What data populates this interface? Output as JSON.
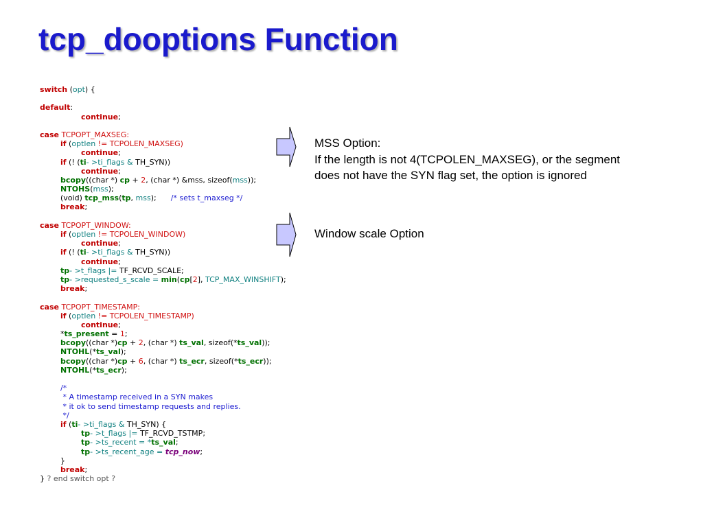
{
  "title": "tcp_dooptions Function",
  "notes": {
    "mss": [
      "MSS Option:",
      "If the length is not 4(TCPOLEN_MAXSEG), or the segment",
      "does not have the SYN flag set, the option is ignored"
    ],
    "window": [
      "Window scale Option"
    ]
  },
  "colors": {
    "title": "#1a1acc",
    "arrow_fill": "#c8c8ff",
    "keyword": "#c00000",
    "identifier": "#108080",
    "function": "#007000",
    "comment": "#1a1ad0"
  },
  "icons": [
    "right-arrow-icon"
  ],
  "code_lines": [
    {
      "indent": 0,
      "tokens": [
        [
          "switch",
          "kw"
        ],
        [
          " (",
          "black"
        ],
        [
          "opt",
          "teal"
        ],
        [
          ") {",
          "black"
        ]
      ]
    },
    {
      "indent": 0,
      "tokens": []
    },
    {
      "indent": 0,
      "tokens": [
        [
          "default",
          "kw"
        ],
        [
          ":",
          "black"
        ]
      ]
    },
    {
      "indent": 2,
      "tokens": [
        [
          "continue",
          "kw"
        ],
        [
          ";",
          "black"
        ]
      ]
    },
    {
      "indent": 0,
      "tokens": []
    },
    {
      "indent": 0,
      "tokens": [
        [
          "case",
          "kw"
        ],
        [
          " TCPOPT_MAXSEG:",
          "red"
        ]
      ]
    },
    {
      "indent": 1,
      "tokens": [
        [
          "if",
          "kw"
        ],
        [
          " (",
          "black"
        ],
        [
          "optlen",
          "teal"
        ],
        [
          " != TCPOLEN_MAXSEG)",
          "red"
        ]
      ]
    },
    {
      "indent": 2,
      "tokens": [
        [
          "continue",
          "kw"
        ],
        [
          ";",
          "black"
        ]
      ]
    },
    {
      "indent": 1,
      "tokens": [
        [
          "if",
          "kw"
        ],
        [
          " (! (",
          "black"
        ],
        [
          "ti",
          "green"
        ],
        [
          "- >ti_flags & ",
          "teal"
        ],
        [
          "TH_SYN",
          "black"
        ],
        [
          "))",
          "black"
        ]
      ]
    },
    {
      "indent": 2,
      "tokens": [
        [
          "continue",
          "kw"
        ],
        [
          ";",
          "black"
        ]
      ]
    },
    {
      "indent": 1,
      "tokens": [
        [
          "bcopy",
          "green"
        ],
        [
          "((char *) ",
          "black"
        ],
        [
          "cp",
          "green"
        ],
        [
          " + ",
          "black"
        ],
        [
          "2",
          "num"
        ],
        [
          ", (char *) &mss, sizeof(",
          "black"
        ],
        [
          "mss",
          "teal"
        ],
        [
          "));",
          "black"
        ]
      ]
    },
    {
      "indent": 1,
      "tokens": [
        [
          "NTOHS",
          "green"
        ],
        [
          "(",
          "black"
        ],
        [
          "mss",
          "teal"
        ],
        [
          ");",
          "black"
        ]
      ]
    },
    {
      "indent": 1,
      "tokens": [
        [
          "(void) ",
          "black"
        ],
        [
          "tcp_mss",
          "green"
        ],
        [
          "(",
          "black"
        ],
        [
          "tp",
          "green"
        ],
        [
          ", ",
          "black"
        ],
        [
          "mss",
          "teal"
        ],
        [
          ");      ",
          "black"
        ],
        [
          "/* sets t_maxseg */",
          "comment"
        ]
      ]
    },
    {
      "indent": 1,
      "tokens": [
        [
          "break",
          "kw"
        ],
        [
          ";",
          "black"
        ]
      ]
    },
    {
      "indent": 0,
      "tokens": []
    },
    {
      "indent": 0,
      "tokens": [
        [
          "case",
          "kw"
        ],
        [
          " TCPOPT_WINDOW:",
          "red"
        ]
      ]
    },
    {
      "indent": 1,
      "tokens": [
        [
          "if",
          "kw"
        ],
        [
          " (",
          "black"
        ],
        [
          "optlen",
          "teal"
        ],
        [
          " != TCPOLEN_WINDOW)",
          "red"
        ]
      ]
    },
    {
      "indent": 2,
      "tokens": [
        [
          "continue",
          "kw"
        ],
        [
          ";",
          "black"
        ]
      ]
    },
    {
      "indent": 1,
      "tokens": [
        [
          "if",
          "kw"
        ],
        [
          " (! (",
          "black"
        ],
        [
          "ti",
          "green"
        ],
        [
          "- >ti_flags & ",
          "teal"
        ],
        [
          "TH_SYN",
          "black"
        ],
        [
          "))",
          "black"
        ]
      ]
    },
    {
      "indent": 2,
      "tokens": [
        [
          "continue",
          "kw"
        ],
        [
          ";",
          "black"
        ]
      ]
    },
    {
      "indent": 1,
      "tokens": [
        [
          "tp",
          "green"
        ],
        [
          "- >t_flags |= ",
          "teal"
        ],
        [
          "TF_RCVD_SCALE",
          "black"
        ],
        [
          ";",
          "black"
        ]
      ]
    },
    {
      "indent": 1,
      "tokens": [
        [
          "tp",
          "green"
        ],
        [
          "- >requested_s_scale = ",
          "teal"
        ],
        [
          "min",
          "green"
        ],
        [
          "(",
          "black"
        ],
        [
          "cp",
          "green"
        ],
        [
          "[",
          "black"
        ],
        [
          "2",
          "num"
        ],
        [
          "], ",
          "black"
        ],
        [
          "TCP_MAX_WINSHIFT",
          "teal"
        ],
        [
          ");",
          "black"
        ]
      ]
    },
    {
      "indent": 1,
      "tokens": [
        [
          "break",
          "kw"
        ],
        [
          ";",
          "black"
        ]
      ]
    },
    {
      "indent": 0,
      "tokens": []
    },
    {
      "indent": 0,
      "tokens": [
        [
          "case",
          "kw"
        ],
        [
          " TCPOPT_TIMESTAMP:",
          "red"
        ]
      ]
    },
    {
      "indent": 1,
      "tokens": [
        [
          "if",
          "kw"
        ],
        [
          " (",
          "black"
        ],
        [
          "optlen",
          "teal"
        ],
        [
          " != TCPOLEN_TIMESTAMP)",
          "red"
        ]
      ]
    },
    {
      "indent": 2,
      "tokens": [
        [
          "continue",
          "kw"
        ],
        [
          ";",
          "black"
        ]
      ]
    },
    {
      "indent": 1,
      "tokens": [
        [
          "*",
          "black"
        ],
        [
          "ts_present",
          "green"
        ],
        [
          " = ",
          "black"
        ],
        [
          "1",
          "num"
        ],
        [
          ";",
          "black"
        ]
      ]
    },
    {
      "indent": 1,
      "tokens": [
        [
          "bcopy",
          "green"
        ],
        [
          "((char *)",
          "black"
        ],
        [
          "cp",
          "green"
        ],
        [
          " + ",
          "black"
        ],
        [
          "2",
          "num"
        ],
        [
          ", (char *) ",
          "black"
        ],
        [
          "ts_val",
          "green"
        ],
        [
          ", sizeof(*",
          "black"
        ],
        [
          "ts_val",
          "green"
        ],
        [
          "));",
          "black"
        ]
      ]
    },
    {
      "indent": 1,
      "tokens": [
        [
          "NTOHL",
          "green"
        ],
        [
          "(*",
          "black"
        ],
        [
          "ts_val",
          "green"
        ],
        [
          ");",
          "black"
        ]
      ]
    },
    {
      "indent": 1,
      "tokens": [
        [
          "bcopy",
          "green"
        ],
        [
          "((char *)",
          "black"
        ],
        [
          "cp",
          "green"
        ],
        [
          " + ",
          "black"
        ],
        [
          "6",
          "num"
        ],
        [
          ", (char *) ",
          "black"
        ],
        [
          "ts_ecr",
          "green"
        ],
        [
          ", sizeof(*",
          "black"
        ],
        [
          "ts_ecr",
          "green"
        ],
        [
          "));",
          "black"
        ]
      ]
    },
    {
      "indent": 1,
      "tokens": [
        [
          "NTOHL",
          "green"
        ],
        [
          "(*",
          "black"
        ],
        [
          "ts_ecr",
          "green"
        ],
        [
          ");",
          "black"
        ]
      ]
    },
    {
      "indent": 0,
      "tokens": []
    },
    {
      "indent": 1,
      "tokens": [
        [
          "/*",
          "comment"
        ]
      ]
    },
    {
      "indent": 1,
      "tokens": [
        [
          " * A timestamp received in a SYN makes",
          "comment"
        ]
      ]
    },
    {
      "indent": 1,
      "tokens": [
        [
          " * it ok to send timestamp requests and replies.",
          "comment"
        ]
      ]
    },
    {
      "indent": 1,
      "tokens": [
        [
          " */",
          "comment"
        ]
      ]
    },
    {
      "indent": 1,
      "tokens": [
        [
          "if",
          "kw"
        ],
        [
          " (",
          "black"
        ],
        [
          "ti",
          "green"
        ],
        [
          "- >ti_flags & ",
          "teal"
        ],
        [
          "TH_SYN",
          "black"
        ],
        [
          ") {",
          "black"
        ]
      ]
    },
    {
      "indent": 2,
      "tokens": [
        [
          "tp",
          "green"
        ],
        [
          "- >t_flags |= ",
          "teal"
        ],
        [
          "TF_RCVD_TSTMP",
          "black"
        ],
        [
          ";",
          "black"
        ]
      ]
    },
    {
      "indent": 2,
      "tokens": [
        [
          "tp",
          "green"
        ],
        [
          "- >ts_recent = *",
          "teal"
        ],
        [
          "ts_val",
          "green"
        ],
        [
          ";",
          "black"
        ]
      ]
    },
    {
      "indent": 2,
      "tokens": [
        [
          "tp",
          "green"
        ],
        [
          "- >ts_recent_age = ",
          "teal"
        ],
        [
          "tcp_now",
          "purple"
        ],
        [
          ";",
          "black"
        ]
      ]
    },
    {
      "indent": 1,
      "tokens": [
        [
          "}",
          "black"
        ]
      ]
    },
    {
      "indent": 1,
      "tokens": [
        [
          "break",
          "kw"
        ],
        [
          ";",
          "black"
        ]
      ]
    },
    {
      "indent": 0,
      "tokens": [
        [
          "} ",
          "black"
        ],
        [
          "? end switch opt ?",
          "grey"
        ]
      ]
    }
  ]
}
